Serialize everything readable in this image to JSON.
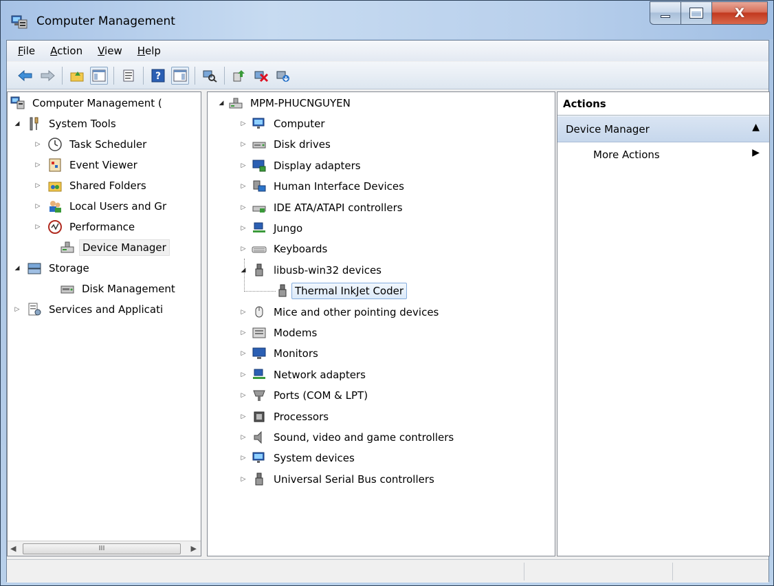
{
  "window": {
    "title": "Computer Management",
    "close_label": "X"
  },
  "menu": {
    "items": [
      {
        "key": "F",
        "rest": "ile"
      },
      {
        "key": "A",
        "rest": "ction"
      },
      {
        "key": "V",
        "rest": "iew"
      },
      {
        "key": "H",
        "rest": "elp"
      }
    ]
  },
  "toolbar": {
    "icons": [
      "back-icon",
      "forward-icon",
      "up-folder-icon",
      "show-hide-tree-icon",
      "properties-icon",
      "help-icon",
      "show-action-pane-icon",
      "scan-hardware-icon",
      "update-driver-icon",
      "uninstall-icon",
      "enable-device-icon"
    ]
  },
  "left_tree": {
    "root": "Computer Management (",
    "system_tools": "System Tools",
    "items": [
      "Task Scheduler",
      "Event Viewer",
      "Shared Folders",
      "Local Users and Gr",
      "Performance",
      "Device Manager"
    ],
    "storage": "Storage",
    "disk_management": "Disk Management",
    "services": "Services and Applicati"
  },
  "device_tree": {
    "root": "MPM-PHUCNGUYEN",
    "categories": [
      "Computer",
      "Disk drives",
      "Display adapters",
      "Human Interface Devices",
      "IDE ATA/ATAPI controllers",
      "Jungo",
      "Keyboards",
      "libusb-win32 devices"
    ],
    "child": "Thermal InkJet Coder",
    "categories_after": [
      "Mice and other pointing devices",
      "Modems",
      "Monitors",
      "Network adapters",
      "Ports (COM & LPT)",
      "Processors",
      "Sound, video and game controllers",
      "System devices",
      "Universal Serial Bus controllers"
    ]
  },
  "actions": {
    "header": "Actions",
    "section": "Device Manager",
    "more": "More Actions"
  },
  "scrollbar": {
    "thumb_grip": "III"
  }
}
